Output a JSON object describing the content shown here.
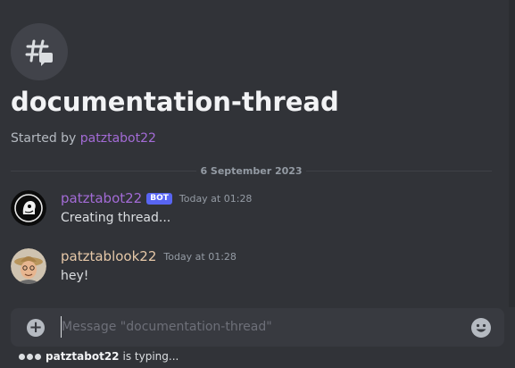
{
  "thread": {
    "title": "documentation-thread",
    "started_by_prefix": "Started by",
    "started_by_user": "patztabot22",
    "icon": "thread-hash-icon"
  },
  "divider": {
    "date": "6 September 2023"
  },
  "messages": [
    {
      "author": "patztabot22",
      "bot_tag": "BOT",
      "time": "Today at 01:28",
      "text": "Creating thread...",
      "author_color": "#a36bd6"
    },
    {
      "author": "patztablook22",
      "time": "Today at 01:28",
      "text": "hey!",
      "author_color": "#e6c8a8"
    }
  ],
  "composer": {
    "placeholder": "Message \"documentation-thread\"",
    "add_icon": "plus-circle-icon",
    "emoji_icon": "emoji-smile-icon"
  },
  "typing": {
    "user": "patztabot22",
    "suffix": "is typing..."
  },
  "colors": {
    "background": "#313338",
    "accent": "#5865f2",
    "bot_username": "#a36bd6"
  }
}
